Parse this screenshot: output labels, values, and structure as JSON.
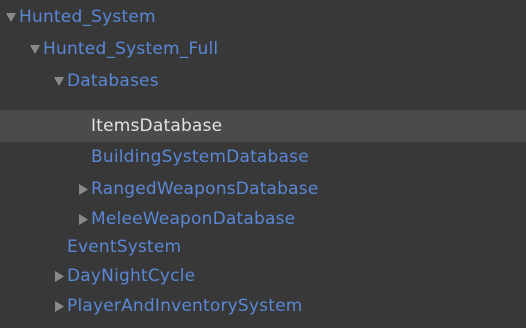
{
  "hierarchy": {
    "colors": {
      "background": "#383838",
      "selected_row": "#4b4b4b",
      "prefab_text": "#5a87d6",
      "selected_text": "#e2e2e2",
      "arrow": "#8a8a8a"
    },
    "items": [
      {
        "label": "Hunted_System",
        "depth": 0,
        "arrow": "expanded",
        "selected": false
      },
      {
        "label": "Hunted_System_Full",
        "depth": 1,
        "arrow": "expanded",
        "selected": false
      },
      {
        "label": "Databases",
        "depth": 2,
        "arrow": "expanded",
        "selected": false
      },
      {
        "label": "ItemsDatabase",
        "depth": 3,
        "arrow": "none",
        "selected": true
      },
      {
        "label": "BuildingSystemDatabase",
        "depth": 3,
        "arrow": "none",
        "selected": false
      },
      {
        "label": "RangedWeaponsDatabase",
        "depth": 3,
        "arrow": "collapsed",
        "selected": false
      },
      {
        "label": "MeleeWeaponDatabase",
        "depth": 3,
        "arrow": "collapsed",
        "selected": false
      },
      {
        "label": "EventSystem",
        "depth": 2,
        "arrow": "none",
        "selected": false
      },
      {
        "label": "DayNightCycle",
        "depth": 2,
        "arrow": "collapsed",
        "selected": false
      },
      {
        "label": "PlayerAndInventorySystem",
        "depth": 2,
        "arrow": "collapsed",
        "selected": false
      }
    ]
  }
}
